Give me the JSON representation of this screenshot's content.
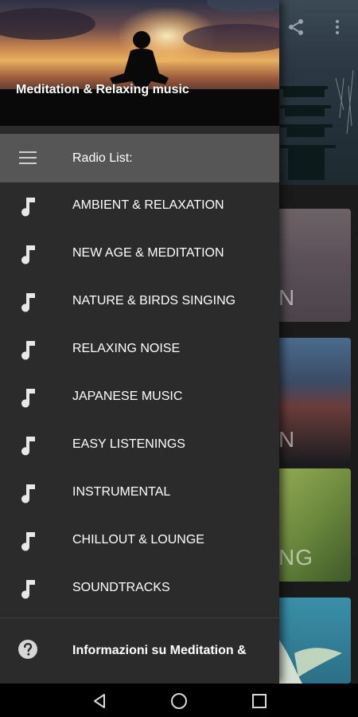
{
  "app": {
    "title": "Meditation & Relaxing music"
  },
  "drawer": {
    "section_header": "Radio List:",
    "items": [
      {
        "label": "AMBIENT & RELAXATION",
        "icon": "music-note-icon"
      },
      {
        "label": "NEW AGE & MEDITATION",
        "icon": "music-note-icon"
      },
      {
        "label": "NATURE & BIRDS SINGING",
        "icon": "music-note-icon"
      },
      {
        "label": "RELAXING NOISE",
        "icon": "music-note-icon"
      },
      {
        "label": "JAPANESE MUSIC",
        "icon": "music-note-icon"
      },
      {
        "label": "EASY LISTENINGS",
        "icon": "music-note-icon"
      },
      {
        "label": "INSTRUMENTAL",
        "icon": "music-note-icon"
      },
      {
        "label": "CHILLOUT & LOUNGE",
        "icon": "music-note-icon"
      },
      {
        "label": "SOUNDTRACKS",
        "icon": "music-note-icon"
      }
    ],
    "about_label": "Informazioni su Meditation &"
  },
  "background": {
    "card_fragments": [
      "N",
      "N",
      "NG"
    ]
  },
  "colors": {
    "drawer_bg": "#2b2b2b",
    "section_bg": "#565656",
    "text": "#ffffff"
  }
}
